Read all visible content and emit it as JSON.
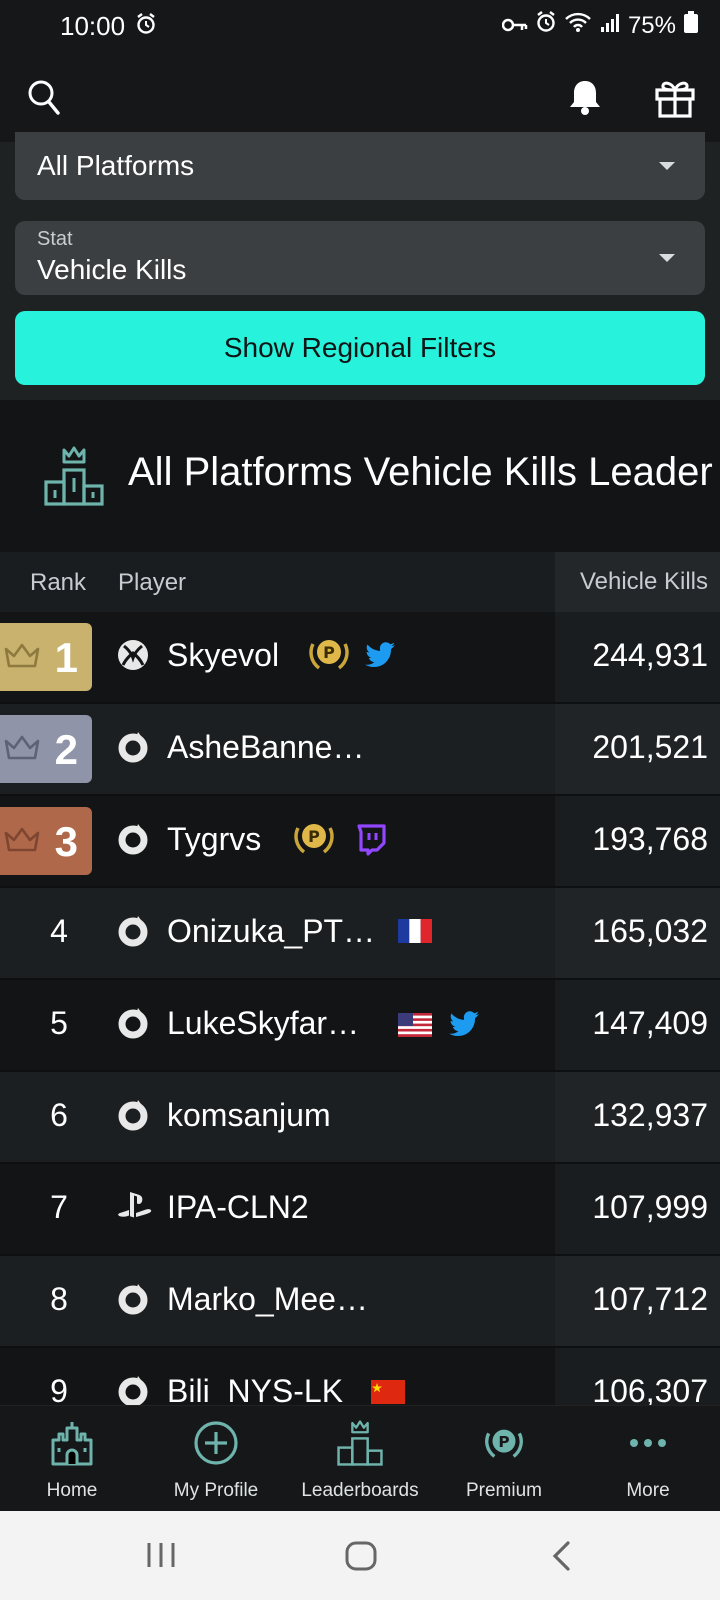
{
  "status_bar": {
    "time": "10:00",
    "battery": "75%"
  },
  "filters": {
    "platform_value": "All Platforms",
    "stat_label": "Stat",
    "stat_value": "Vehicle Kills",
    "regional_button": "Show Regional Filters"
  },
  "board": {
    "title": "All Platforms Vehicle Kills Leader"
  },
  "table": {
    "headers": {
      "rank": "Rank",
      "player": "Player",
      "stat": "Vehicle Kills"
    },
    "rows": [
      {
        "rank": "1",
        "platform": "xbox-icon",
        "name": "Skyevol",
        "value": "244,931",
        "badges": [
          "premium-icon",
          "twitter-icon"
        ]
      },
      {
        "rank": "2",
        "platform": "origin-icon",
        "name": "AsheBanne…",
        "value": "201,521",
        "badges": []
      },
      {
        "rank": "3",
        "platform": "origin-icon",
        "name": "Tygrvs",
        "value": "193,768",
        "badges": [
          "premium-icon",
          "twitch-icon"
        ]
      },
      {
        "rank": "4",
        "platform": "origin-icon",
        "name": "Onizuka_PT…",
        "value": "165,032",
        "badges": [
          "flag-france-icon"
        ]
      },
      {
        "rank": "5",
        "platform": "origin-icon",
        "name": "LukeSkyfar…",
        "value": "147,409",
        "badges": [
          "flag-usa-icon",
          "twitter-icon"
        ]
      },
      {
        "rank": "6",
        "platform": "origin-icon",
        "name": "komsanjum",
        "value": "132,937",
        "badges": []
      },
      {
        "rank": "7",
        "platform": "playstation-icon",
        "name": "IPA-CLN2",
        "value": "107,999",
        "badges": []
      },
      {
        "rank": "8",
        "platform": "origin-icon",
        "name": "Marko_Mee…",
        "value": "107,712",
        "badges": []
      },
      {
        "rank": "9",
        "platform": "origin-icon",
        "name": "Bili_NYS-LK",
        "value": "106,307",
        "badges": [
          "flag-china-icon"
        ]
      }
    ]
  },
  "colors": {
    "accent": "#27f2dc",
    "gold": "#c9b26d",
    "silver": "#8f94a8",
    "bronze": "#b0684a",
    "icon_teal": "#6fb3ad"
  },
  "nav": {
    "home": "Home",
    "profile": "My Profile",
    "leaderboards": "Leaderboards",
    "premium": "Premium",
    "more": "More"
  }
}
